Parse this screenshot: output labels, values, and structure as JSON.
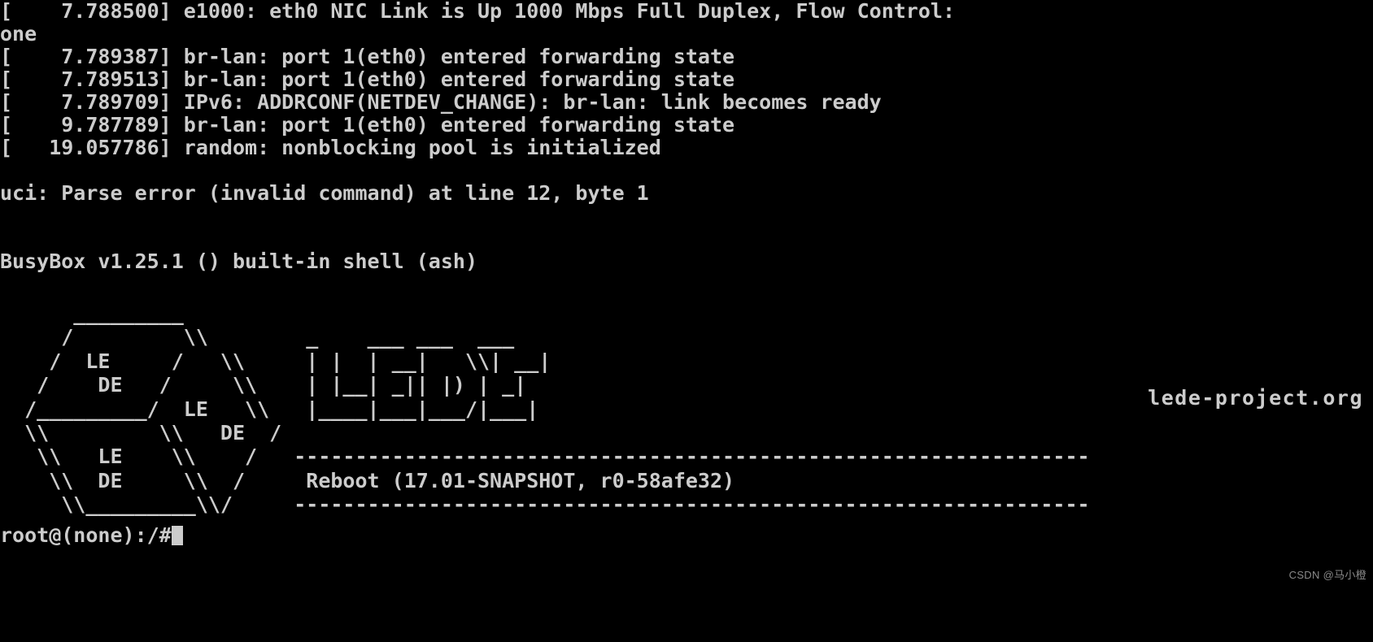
{
  "terminal": {
    "background_color": "#000000",
    "foreground_color": "#cccccc",
    "boot_log": [
      "[    7.788500] e1000: eth0 NIC Link is Up 1000 Mbps Full Duplex, Flow Control:",
      "one",
      "[    7.789387] br-lan: port 1(eth0) entered forwarding state",
      "[    7.789513] br-lan: port 1(eth0) entered forwarding state",
      "[    7.789709] IPv6: ADDRCONF(NETDEV_CHANGE): br-lan: link becomes ready",
      "[    9.787789] br-lan: port 1(eth0) entered forwarding state",
      "[   19.057786] random: nonblocking pool is initialized"
    ],
    "uci_error": "uci: Parse error (invalid command) at line 12, byte 1",
    "busybox_banner": "BusyBox v1.25.1 () built-in shell (ash)",
    "ascii_banner": " _________\n/         \\\\      /\\\\\n\n",
    "banner_lines": [
      "     _________                                                                   ",
      "    /         \\\\        _    ___ ___  ___                                        ",
      "   /  LE     /  \\\\     | |  | __|   \\\\| __|                                       ",
      "  /    DE   /    \\\\    | |__| _|| |) | _|                                        ",
      " /_________/  LE  \\\\   |____|___|___/|___|                                       ",
      " \\\\         \\\\  DE  /                                                             ",
      "  \\\\   LE    \\\\    /   ---------------------------------------------------------  ",
      "   \\\\  DE     \\\\  /     Reboot (17.01-SNAPSHOT, r0-58afe32)                       ",
      "    \\\\_________\\\\/     ---------------------------------------------------------  "
    ],
    "site_url": "lede-project.org",
    "release_banner": {
      "divider": "-----------------------------------------------------------------",
      "text": "Reboot (17.01-SNAPSHOT, r0-58afe32)"
    },
    "logo_labels": [
      "LE",
      "DE",
      "LE",
      "DE",
      "LE",
      "DE"
    ],
    "logo_wordmark": "LEDE",
    "prompt": "root@(none):/#",
    "cursor_visible": true
  },
  "watermark": {
    "text": "CSDN @马小橙"
  }
}
